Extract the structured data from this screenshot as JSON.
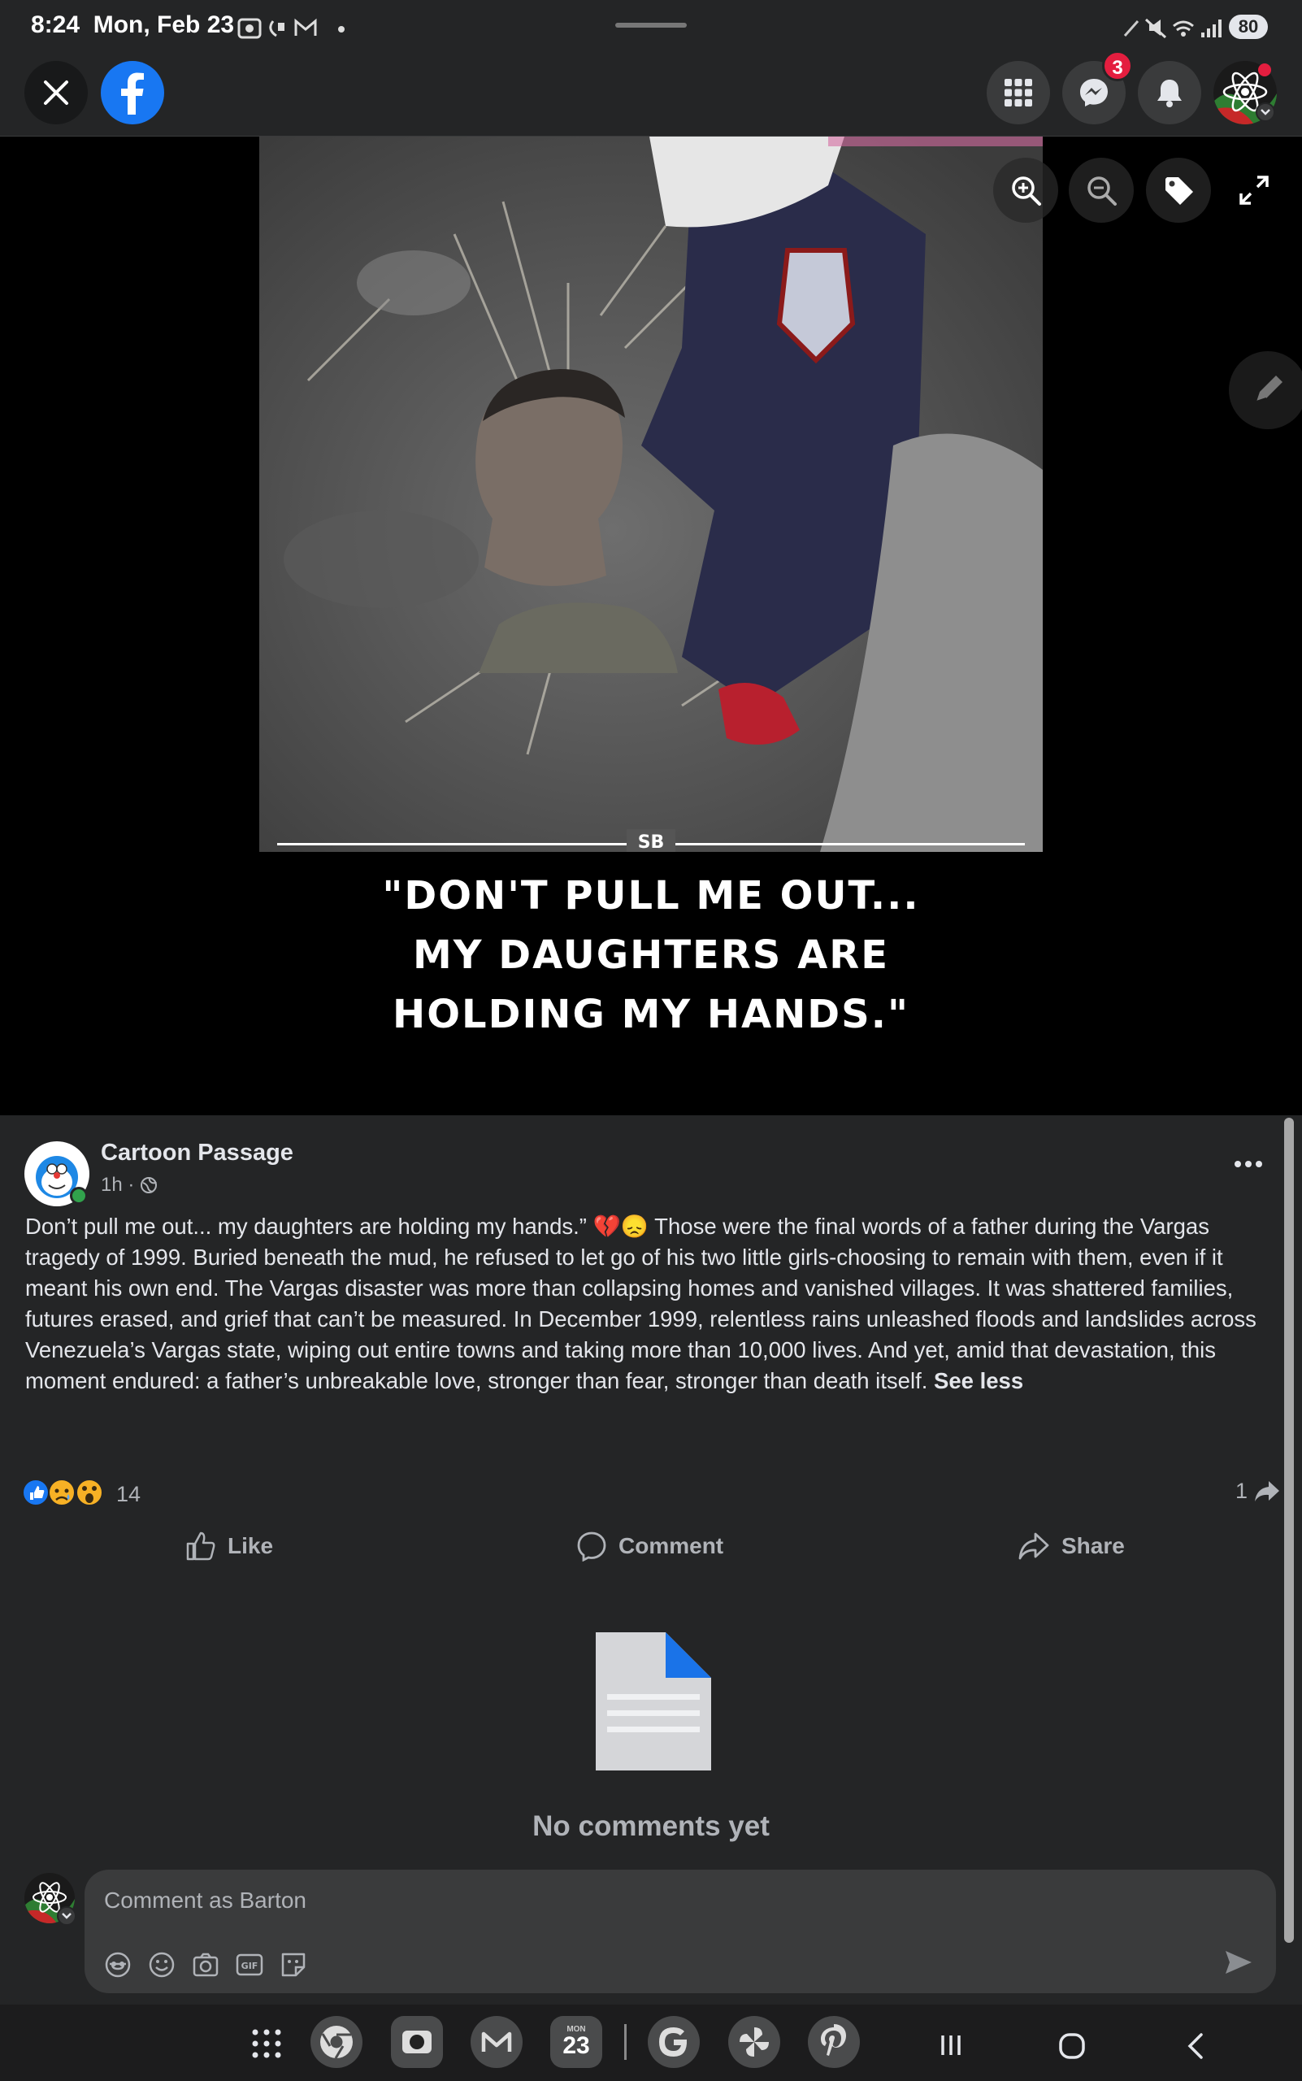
{
  "status_bar": {
    "time": "8:24",
    "date": "Mon, Feb 23",
    "battery": "80"
  },
  "header": {
    "messenger_badge": "3"
  },
  "media": {
    "watermark": "SB",
    "caption_lines": [
      "\"DON'T PULL ME OUT...",
      "MY DAUGHTERS ARE",
      "HOLDING MY HANDS.\""
    ]
  },
  "post": {
    "author": "Cartoon Passage",
    "time": "1h",
    "text": "Don’t pull me out... my daughters are holding my hands.” 💔😞 Those were the final words of a father during the Vargas tragedy of 1999. Buried beneath the mud, he refused to let go of his two little girls-choosing to remain with them, even if it meant his own end. The Vargas disaster was more than collapsing homes and vanished villages. It was shattered families, futures erased, and grief that can’t be measured. In December 1999, relentless rains unleashed floods and landslides across Venezuela’s Vargas state, wiping out entire towns and taking more than 10,000 lives. And yet, amid that devastation, this moment endured: a father’s unbreakable love, stronger than fear, stronger than death itself.",
    "see_less": "See less",
    "reaction_count": "14",
    "share_count": "1",
    "actions": {
      "like": "Like",
      "comment": "Comment",
      "share": "Share"
    }
  },
  "comments": {
    "empty_label": "No comments yet",
    "input_placeholder": "Comment as Barton"
  },
  "dock": {
    "calendar_month": "MON",
    "calendar_day": "23"
  },
  "colors": {
    "accent": "#1877f2",
    "badge": "#e41e3f",
    "background": "#242526"
  }
}
